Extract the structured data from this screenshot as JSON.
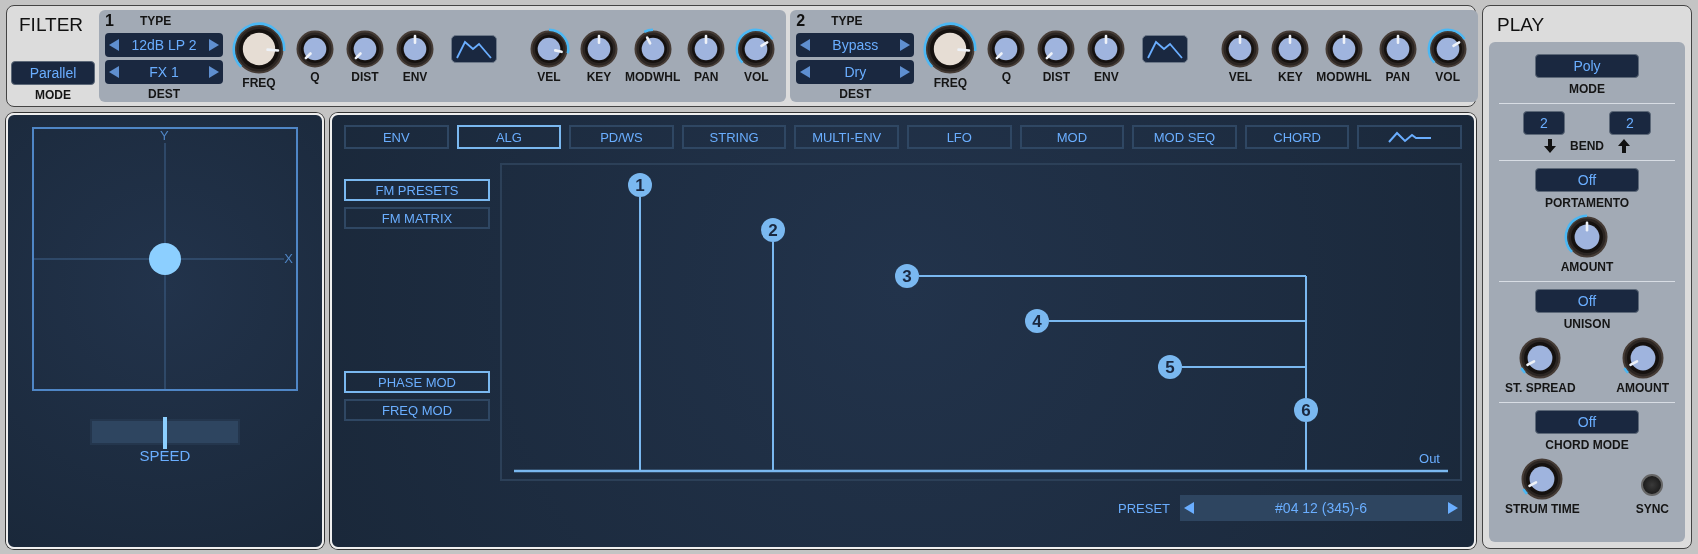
{
  "filter": {
    "title": "FILTER",
    "mode": {
      "value": "Parallel",
      "label": "MODE"
    },
    "slots": [
      {
        "number": "1",
        "type_label": "TYPE",
        "type": "12dB LP 2",
        "dest": "FX 1",
        "dest_label": "DEST",
        "knobs": [
          {
            "label": "FREQ",
            "level": 0.85,
            "kind": "large"
          },
          {
            "label": "Q",
            "level": 0,
            "kind": "unipolar"
          },
          {
            "label": "DIST",
            "level": 0,
            "kind": "unipolar"
          },
          {
            "label": "ENV",
            "level": 0.5,
            "kind": "bipolar"
          }
        ],
        "mod_knobs": [
          {
            "label": "VEL",
            "level": 0.88,
            "kind": "bipolar"
          },
          {
            "label": "KEY",
            "level": 0.5,
            "kind": "bipolar"
          },
          {
            "label": "MODWHL",
            "level": 0.4,
            "kind": "bipolar"
          },
          {
            "label": "PAN",
            "level": 0.5,
            "kind": "bipolar"
          },
          {
            "label": "VOL",
            "level": 0.72,
            "kind": "unipolar"
          }
        ]
      },
      {
        "number": "2",
        "type_label": "TYPE",
        "type": "Bypass",
        "dest": "Dry",
        "dest_label": "DEST",
        "knobs": [
          {
            "label": "FREQ",
            "level": 0.85,
            "kind": "large"
          },
          {
            "label": "Q",
            "level": 0,
            "kind": "unipolar"
          },
          {
            "label": "DIST",
            "level": 0,
            "kind": "unipolar"
          },
          {
            "label": "ENV",
            "level": 0.5,
            "kind": "bipolar"
          }
        ],
        "mod_knobs": [
          {
            "label": "VEL",
            "level": 0.5,
            "kind": "bipolar"
          },
          {
            "label": "KEY",
            "level": 0.5,
            "kind": "bipolar"
          },
          {
            "label": "MODWHL",
            "level": 0.5,
            "kind": "bipolar"
          },
          {
            "label": "PAN",
            "level": 0.5,
            "kind": "bipolar"
          },
          {
            "label": "VOL",
            "level": 0.72,
            "kind": "unipolar"
          }
        ]
      }
    ]
  },
  "xy_pad": {
    "y_label": "Y",
    "x_label": "X",
    "speed": {
      "label": "SPEED",
      "level": 0.5
    }
  },
  "editor": {
    "tabs": [
      {
        "kind": "text",
        "label": "ENV",
        "selected": false
      },
      {
        "kind": "text",
        "label": "ALG",
        "selected": true
      },
      {
        "kind": "text",
        "label": "PD/WS",
        "selected": false
      },
      {
        "kind": "text",
        "label": "STRING",
        "selected": false
      },
      {
        "kind": "text",
        "label": "MULTI-ENV",
        "selected": false
      },
      {
        "kind": "text",
        "label": "LFO",
        "selected": false
      },
      {
        "kind": "text",
        "label": "MOD",
        "selected": false
      },
      {
        "kind": "text",
        "label": "MOD SEQ",
        "selected": false
      },
      {
        "kind": "text",
        "label": "CHORD",
        "selected": false
      },
      {
        "kind": "wave",
        "selected": false
      }
    ],
    "views": [
      {
        "label": "FM PRESETS",
        "selected": true
      },
      {
        "label": "FM MATRIX",
        "selected": false
      }
    ],
    "fm_modes": [
      {
        "label": "PHASE MOD",
        "selected": true
      },
      {
        "label": "FREQ MOD",
        "selected": false
      }
    ],
    "algorithm": {
      "operators": [
        "1",
        "2",
        "3",
        "4",
        "5",
        "6"
      ],
      "out_label": "Out"
    },
    "preset": {
      "label": "PRESET",
      "value": "#04 12 (345)-6"
    }
  },
  "play": {
    "title": "PLAY",
    "mode": {
      "value": "Poly",
      "label": "MODE"
    },
    "bend": {
      "down": "2",
      "up": "2",
      "label": "BEND"
    },
    "portamento": {
      "value": "Off",
      "label": "PORTAMENTO",
      "amount": {
        "label": "AMOUNT",
        "level": 0.5,
        "kind": "unipolar"
      }
    },
    "unison": {
      "value": "Off",
      "label": "UNISON",
      "knobs": [
        {
          "label": "ST. SPREAD",
          "level": 0.06,
          "kind": "unipolar"
        },
        {
          "label": "AMOUNT",
          "level": 0.06,
          "kind": "unipolar"
        }
      ]
    },
    "chord": {
      "value": "Off",
      "label": "CHORD MODE",
      "strum": {
        "label": "STRUM TIME",
        "level": 0.06,
        "kind": "unipolar"
      },
      "sync_label": "SYNC"
    }
  }
}
